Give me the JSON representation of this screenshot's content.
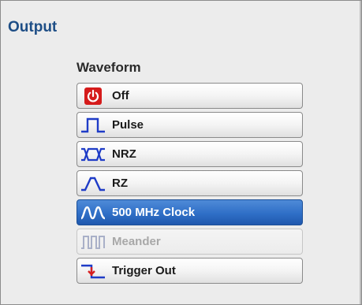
{
  "panel": {
    "title": "Output",
    "group_label": "Waveform"
  },
  "waveform_options": [
    {
      "label": "Off",
      "icon": "power-icon",
      "state": "normal"
    },
    {
      "label": "Pulse",
      "icon": "pulse-wave-icon",
      "state": "normal"
    },
    {
      "label": "NRZ",
      "icon": "nrz-wave-icon",
      "state": "normal"
    },
    {
      "label": "RZ",
      "icon": "rz-wave-icon",
      "state": "normal"
    },
    {
      "label": "500 MHz Clock",
      "icon": "sine-wave-icon",
      "state": "selected"
    },
    {
      "label": "Meander",
      "icon": "meander-wave-icon",
      "state": "disabled"
    },
    {
      "label": "Trigger Out",
      "icon": "trigger-out-icon",
      "state": "normal"
    }
  ],
  "colors": {
    "title": "#1e4e86",
    "icon_blue": "#1f3cc7",
    "power_red": "#d51b1b",
    "trigger_red": "#d81f1f",
    "selected_bg": "#2f6fc7",
    "disabled_text": "#a8a8a8"
  }
}
